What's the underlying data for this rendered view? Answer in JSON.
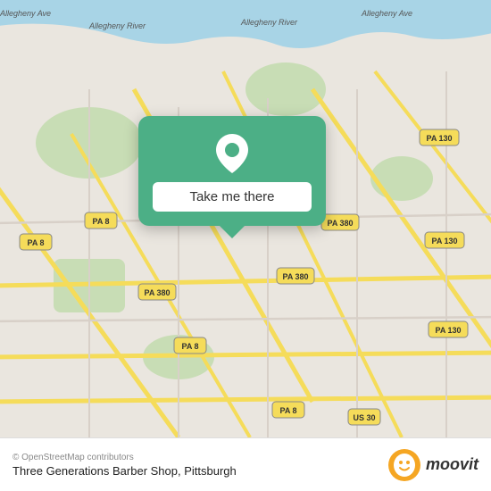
{
  "map": {
    "attribution": "© OpenStreetMap contributors",
    "background_color": "#e8e0d8"
  },
  "popup": {
    "button_label": "Take me there",
    "bg_color": "#4caf86"
  },
  "bottom_bar": {
    "copyright": "© OpenStreetMap contributors",
    "place_name": "Three Generations Barber Shop, Pittsburgh",
    "moovit_label": "moovit"
  }
}
